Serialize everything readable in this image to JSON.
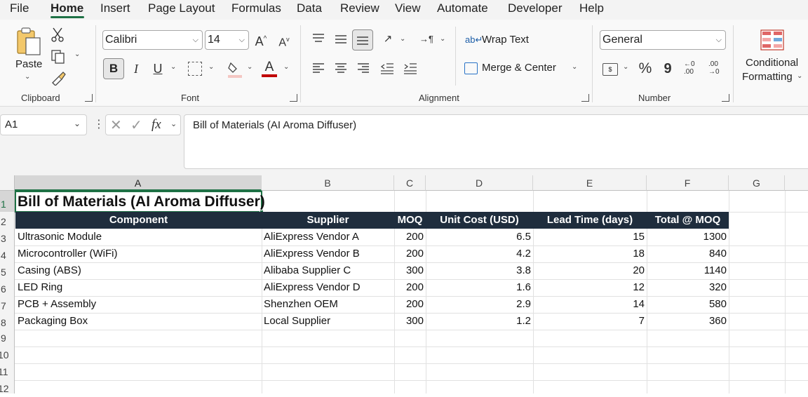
{
  "menu": {
    "file": "File",
    "home": "Home",
    "insert": "Insert",
    "page_layout": "Page Layout",
    "formulas": "Formulas",
    "data": "Data",
    "review": "Review",
    "view": "View",
    "automate": "Automate",
    "developer": "Developer",
    "help": "Help"
  },
  "ribbon": {
    "clipboard": {
      "paste_label": "Paste",
      "group_label": "Clipboard"
    },
    "font": {
      "font_name": "Calibri",
      "font_size": "14",
      "group_label": "Font",
      "bold": "B",
      "italic": "I",
      "underline": "U",
      "font_color": "#c00000"
    },
    "alignment": {
      "wrap_text": "Wrap Text",
      "merge_center": "Merge & Center",
      "group_label": "Alignment"
    },
    "number": {
      "format": "General",
      "percent": "%",
      "comma": "9",
      "group_label": "Number",
      "increase_decimal": "←0\n.00",
      "decrease_decimal": ".00\n→0"
    },
    "styles": {
      "conditional_formatting_line1": "Conditional",
      "conditional_formatting_line2": "Formatting"
    }
  },
  "formula_bar": {
    "name_box": "A1",
    "fx": "fx",
    "content": "Bill of Materials (AI Aroma Diffuser)"
  },
  "sheet": {
    "columns": [
      "A",
      "B",
      "C",
      "D",
      "E",
      "F",
      "G"
    ],
    "rows": [
      "1",
      "2",
      "3",
      "4",
      "5",
      "6",
      "7",
      "8",
      "9",
      "10",
      "11",
      "12"
    ],
    "title": "Bill of Materials (AI Aroma Diffuser)",
    "headers": [
      "Component",
      "Supplier",
      "MOQ",
      "Unit Cost (USD)",
      "Lead Time (days)",
      "Total @ MOQ"
    ],
    "data": [
      [
        "Ultrasonic Module",
        "AliExpress Vendor A",
        "200",
        "6.5",
        "15",
        "1300"
      ],
      [
        "Microcontroller (WiFi)",
        "AliExpress Vendor B",
        "200",
        "4.2",
        "18",
        "840"
      ],
      [
        "Casing (ABS)",
        "Alibaba Supplier C",
        "300",
        "3.8",
        "20",
        "1140"
      ],
      [
        "LED Ring",
        "AliExpress Vendor D",
        "200",
        "1.6",
        "12",
        "320"
      ],
      [
        "PCB + Assembly",
        "Shenzhen OEM",
        "200",
        "2.9",
        "14",
        "580"
      ],
      [
        "Packaging Box",
        "Local Supplier",
        "300",
        "1.2",
        "7",
        "360"
      ]
    ],
    "header_fill": "#1f2d3d",
    "selection_color": "#1e7145"
  }
}
